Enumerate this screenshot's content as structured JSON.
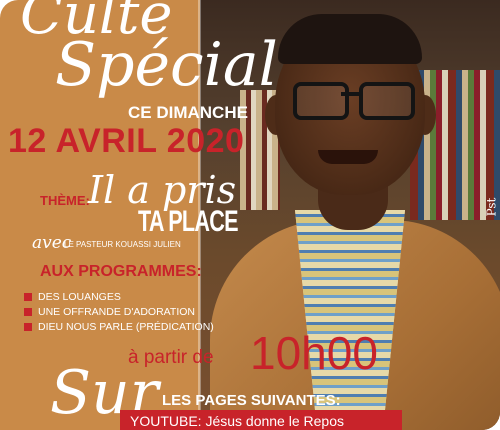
{
  "poster": {
    "title_line1": "Culte",
    "title_line2": "Spécial",
    "subtitle": "CE DIMANCHE",
    "date": "12 AVRIL 2020",
    "theme_label": "THÈME:",
    "theme_script": "Il a pris",
    "theme_main": "TA PLACE",
    "avec_script": "avec",
    "pastor": "LE PASTEUR KOUASSI JULIEN",
    "program_title": "AUX PROGRAMMES:",
    "program_items": [
      "DES LOUANGES",
      "UNE OFFRANDE D'ADORATION",
      "DIEU NOUS PARLE (PRÉDICATION)"
    ],
    "time_prefix": "à partir de",
    "time": "10h00",
    "sur_script": "Sur",
    "pages_title": "LES PAGES SUIVANTES:",
    "youtube": "YOUTUBE: Jésus donne le Repos",
    "photo_signature": "Pst"
  },
  "colors": {
    "accent_red": "#c8232a",
    "background_tan": "#c98a48",
    "text_white": "#ffffff"
  }
}
